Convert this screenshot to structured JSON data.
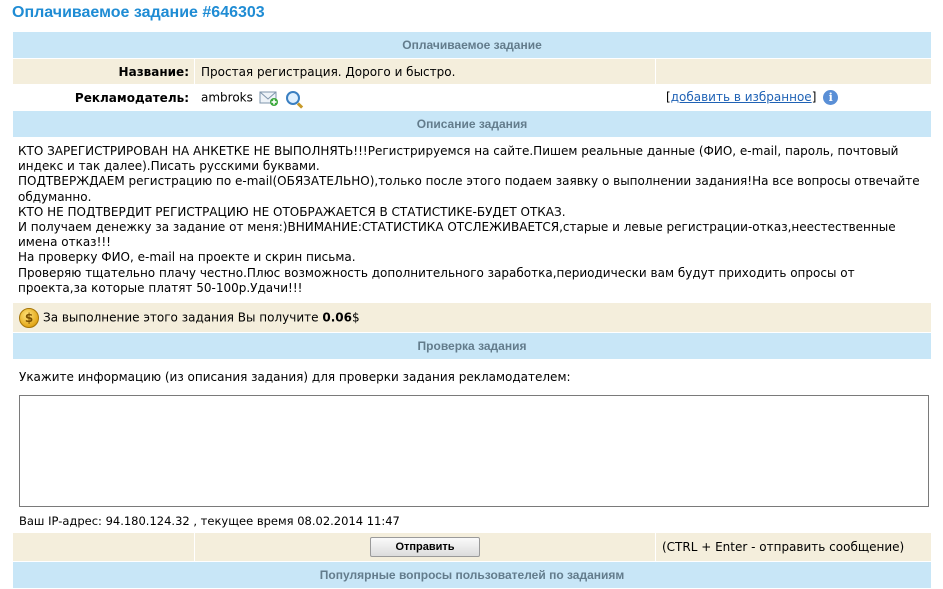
{
  "page": {
    "title": "Оплачиваемое задание #646303"
  },
  "task": {
    "header": "Оплачиваемое задание",
    "name_label": "Название:",
    "name_value": "Простая регистрация. Дорого и быстро.",
    "advertiser_label": "Рекламодатель:",
    "advertiser_value": "ambroks",
    "bracket_open": "[",
    "favorite_link": "добавить в избранное",
    "bracket_close": "]"
  },
  "description": {
    "header": "Описание задания",
    "lines": [
      "КТО ЗАРЕГИСТРИРОВАН НА АНКЕТКЕ НЕ ВЫПОЛНЯТЬ!!!Регистрируемся на сайте.Пишем реальные данные (ФИО, e-mail, пароль, почтовый индекс и так далее).Писать русскими буквами.",
      "ПОДТВЕРЖДАЕМ регистрацию по e-mail(ОБЯЗАТЕЛЬНО),только после этого подаем заявку о выполнении задания!На все вопросы отвечайте обдуманно.",
      "КТО НЕ ПОДТВЕРДИТ РЕГИСТРАЦИЮ НЕ ОТОБРАЖАЕТСЯ В СТАТИСТИКЕ-БУДЕТ ОТКАЗ.",
      "И получаем денежку за задание от меня:)ВНИМАНИЕ:СТАТИСТИКА ОТСЛЕЖИВАЕТСЯ,старые и левые регистрации-отказ,неестественные имена отказ!!!",
      "На проверку ФИО, e-mail на проекте и скрин письма.",
      "Проверяю тщательно плачу честно.Плюс возможность дополнительного заработка,периодически вам будут приходить опросы от проекта,за которые платят 50-100р.Удачи!!!"
    ],
    "reward_text": "За выполнение этого задания Вы получите",
    "reward_amount": "0.06",
    "reward_currency": "$",
    "coin_symbol": "$"
  },
  "verification": {
    "header": "Проверка задания",
    "instruction": "Укажите информацию (из описания задания) для проверки задания рекламодателем:",
    "textarea_value": "",
    "ip_line": "Ваш IP-адрес: 94.180.124.32 , текущее время 08.02.2014 11:47",
    "send_button": "Отправить",
    "hint": "(CTRL + Enter - отправить сообщение)"
  },
  "faq": {
    "header": "Популярные вопросы пользователей по заданиям"
  },
  "colors": {
    "title": "#1f8cd4",
    "header_bg": "#c8e6f7",
    "header_text": "#637c8c",
    "beige": "#f4eedc"
  }
}
